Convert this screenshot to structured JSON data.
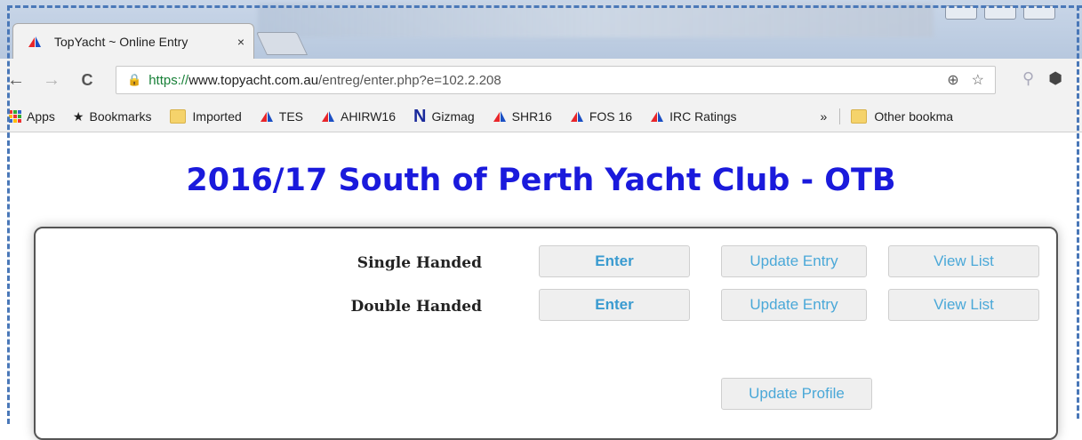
{
  "browser": {
    "tab": {
      "title": "TopYacht ~ Online Entry",
      "close": "×"
    },
    "nav": {
      "back": "←",
      "forward": "→",
      "reload": "C"
    },
    "url": {
      "scheme": "https://",
      "host": "www.topyacht.com.au",
      "path": "/entreg/enter.php?e=102.2.208"
    },
    "omni_icons": {
      "zoom": "⊕",
      "star": "☆"
    },
    "bookmarks": [
      {
        "label": "Apps",
        "icon": "apps-grid-icon"
      },
      {
        "label": "Bookmarks",
        "icon": "star-icon"
      },
      {
        "label": "Imported",
        "icon": "folder-icon"
      },
      {
        "label": "TES",
        "icon": "sail-icon"
      },
      {
        "label": "AHIRW16",
        "icon": "sail-icon"
      },
      {
        "label": "Gizmag",
        "icon": "n-logo-icon"
      },
      {
        "label": "SHR16",
        "icon": "sail-icon"
      },
      {
        "label": "FOS 16",
        "icon": "sail-icon"
      },
      {
        "label": "IRC Ratings",
        "icon": "sail-icon"
      }
    ],
    "overflow": "»",
    "other_bookmarks": "Other bookma"
  },
  "page": {
    "title": "2016/17 South of Perth Yacht Club - OTB",
    "rows": [
      {
        "label": "Single Handed",
        "enter": "Enter",
        "update": "Update Entry",
        "view": "View List"
      },
      {
        "label": "Double Handed",
        "enter": "Enter",
        "update": "Update Entry",
        "view": "View List"
      }
    ],
    "update_profile": "Update Profile"
  },
  "colors": {
    "title": "#1a1adc",
    "button_text": "#4aa8d8",
    "frame": "#4a78b8"
  }
}
